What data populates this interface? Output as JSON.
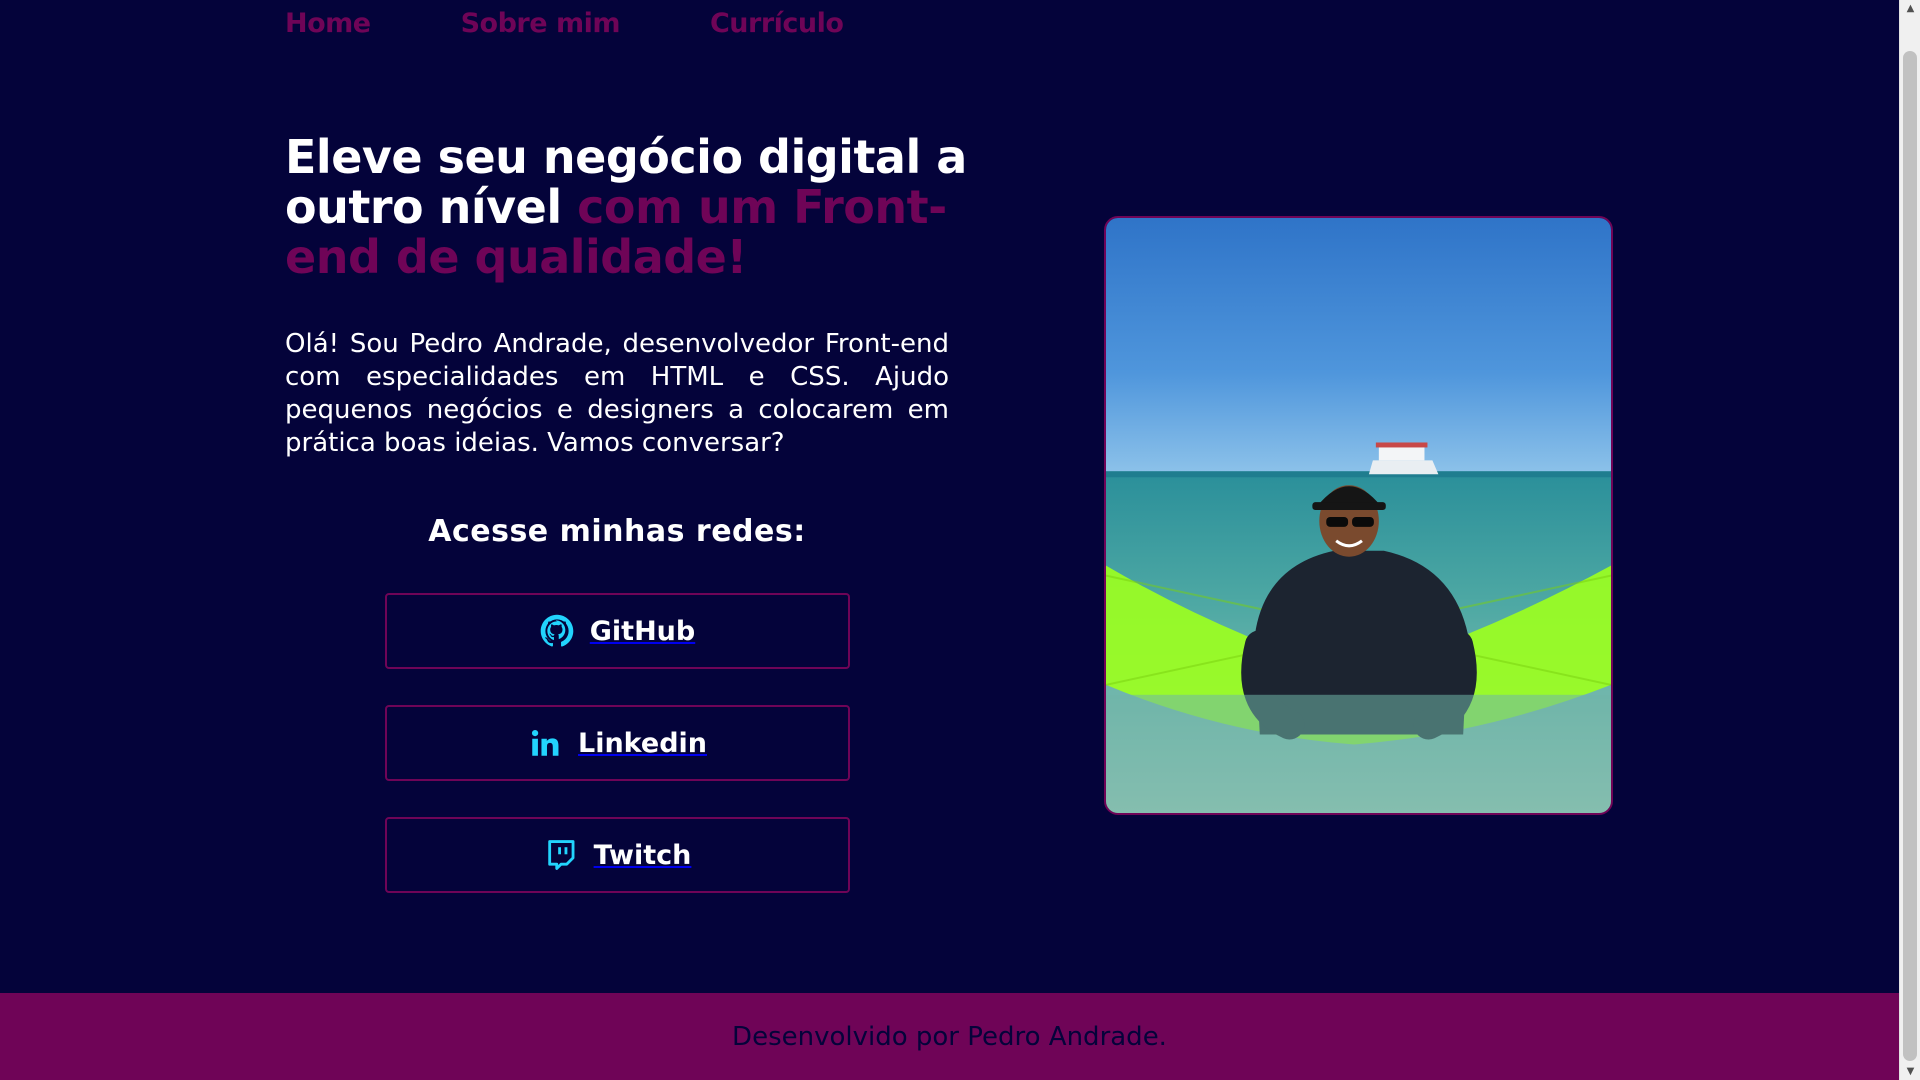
{
  "nav": {
    "items": [
      {
        "label": "Home"
      },
      {
        "label": "Sobre mim"
      },
      {
        "label": "Currículo"
      }
    ]
  },
  "hero": {
    "title_main": "Eleve seu negócio digital a outro nível ",
    "title_accent": "com um Front-end de qualidade!",
    "intro": "Olá! Sou Pedro Andrade, desenvolvedor Front-end com especialidades em HTML e CSS. Ajudo pequenos negócios e designers a colocarem em prática boas ideias. Vamos conversar?"
  },
  "socials": {
    "heading": "Acesse minhas redes:",
    "links": [
      {
        "label": "GitHub",
        "icon": "github-icon"
      },
      {
        "label": "Linkedin",
        "icon": "linkedin-icon"
      },
      {
        "label": "Twitch",
        "icon": "twitch-icon"
      }
    ]
  },
  "photo": {
    "icon": "profile-photo"
  },
  "footer": {
    "text": "Desenvolvido por Pedro Andrade."
  },
  "scrollbar": {
    "up_arrow": "▲",
    "down_arrow": "▼"
  },
  "colors": {
    "background": "#04033a",
    "accent": "#6f0457",
    "icon_color": "#22d4fd",
    "text": "#ffffff"
  }
}
